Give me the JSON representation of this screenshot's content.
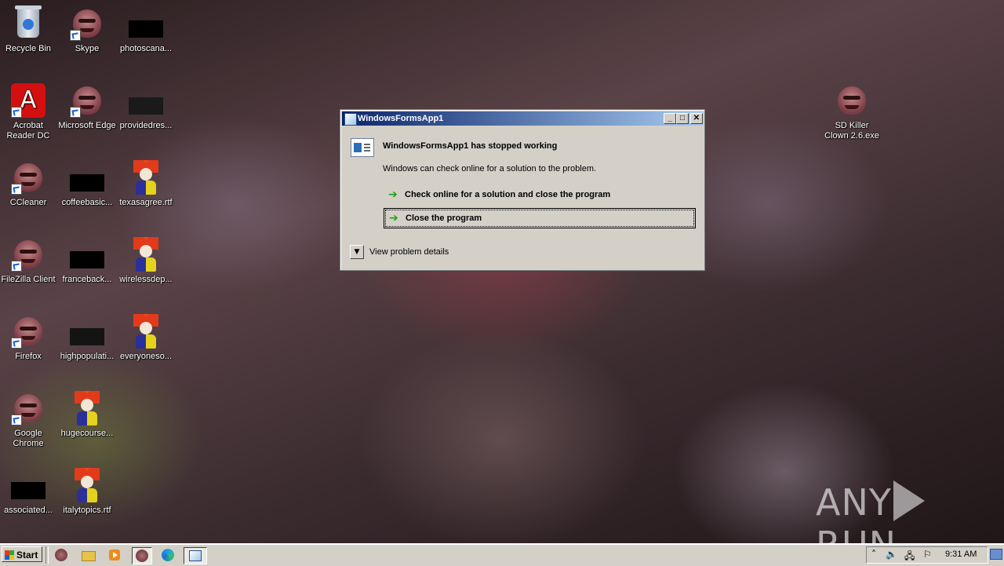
{
  "desktop": {
    "icons": [
      {
        "label": "Recycle Bin",
        "icon": "recycle-bin-icon"
      },
      {
        "label": "Skype",
        "icon": "clown-face-icon"
      },
      {
        "label": "photoscana...",
        "icon": "black-thumbnail-icon"
      },
      {
        "label": "Acrobat Reader DC",
        "icon": "acrobat-icon"
      },
      {
        "label": "Microsoft Edge",
        "icon": "clown-face-icon"
      },
      {
        "label": "providedres...",
        "icon": "black-thumbnail-icon"
      },
      {
        "label": "SD Killer Clown 2.6.exe",
        "icon": "clown-face-icon"
      },
      {
        "label": "CCleaner",
        "icon": "clown-face-icon"
      },
      {
        "label": "coffeebasic...",
        "icon": "black-thumbnail-icon"
      },
      {
        "label": "texasagree.rtf",
        "icon": "clown-doc-icon"
      },
      {
        "label": "FileZilla Client",
        "icon": "clown-face-icon"
      },
      {
        "label": "franceback...",
        "icon": "black-thumbnail-icon"
      },
      {
        "label": "wirelessdep...",
        "icon": "clown-doc-icon"
      },
      {
        "label": "Firefox",
        "icon": "clown-face-icon"
      },
      {
        "label": "highpopulati...",
        "icon": "black-thumbnail-icon"
      },
      {
        "label": "everyoneso...",
        "icon": "clown-doc-icon"
      },
      {
        "label": "Google Chrome",
        "icon": "clown-face-icon"
      },
      {
        "label": "hugecourse...",
        "icon": "clown-doc-icon"
      },
      {
        "label": "associated...",
        "icon": "black-thumbnail-icon"
      },
      {
        "label": "italytopics.rtf",
        "icon": "clown-doc-icon"
      }
    ]
  },
  "dialog": {
    "title": "WindowsFormsApp1",
    "heading": "WindowsFormsApp1 has stopped working",
    "subtext": "Windows can check online for a solution to the problem.",
    "commands": [
      {
        "label": "Check online for a solution and close the program"
      },
      {
        "label": "Close the program"
      }
    ],
    "details_label": "View problem details",
    "minimize_glyph": "_",
    "maximize_glyph": "□",
    "close_glyph": "✕"
  },
  "taskbar": {
    "start_label": "Start",
    "clock": "9:31 AM"
  },
  "watermark": {
    "left": "ANY",
    "right": "RUN"
  }
}
